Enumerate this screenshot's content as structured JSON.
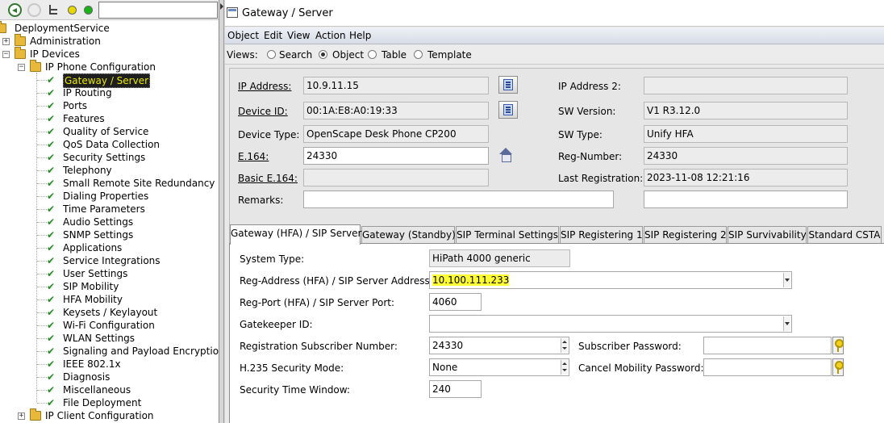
{
  "left_toolbar": {
    "search_value": ""
  },
  "tree": {
    "root": "DeploymentService",
    "administration": "Administration",
    "ip_devices": "IP Devices",
    "ip_phone_configuration": "IP Phone Configuration",
    "items": [
      "Gateway / Server",
      "IP Routing",
      "Ports",
      "Features",
      "Quality of Service",
      "QoS Data Collection",
      "Security Settings",
      "Telephony",
      "Small Remote Site Redundancy",
      "Dialing Properties",
      "Time Parameters",
      "Audio Settings",
      "SNMP Settings",
      "Applications",
      "Service Integrations",
      "User Settings",
      "SIP Mobility",
      "HFA Mobility",
      "Keysets / Keylayout",
      "Wi-Fi Configuration",
      "WLAN Settings",
      "Signaling and Payload Encryption (",
      "IEEE 802.1x",
      "Diagnosis",
      "Miscellaneous",
      "File Deployment"
    ],
    "ip_client_configuration": "IP Client Configuration",
    "selected_index": 0
  },
  "window": {
    "title": "Gateway / Server"
  },
  "menu": [
    "Object",
    "Edit",
    "View",
    "Action",
    "Help"
  ],
  "views": {
    "label": "Views:",
    "options": [
      "Search",
      "Object",
      "Table",
      "Template"
    ],
    "selected": "Object"
  },
  "form": {
    "ip_address": {
      "label": "IP Address:",
      "value": "10.9.11.15"
    },
    "device_id": {
      "label": "Device ID:",
      "value": "00:1A:E8:A0:19:33"
    },
    "device_type": {
      "label": "Device Type:",
      "value": "OpenScape Desk Phone CP200"
    },
    "e164": {
      "label": "E.164:",
      "value": "24330"
    },
    "basic_e164": {
      "label": "Basic E.164:",
      "value": ""
    },
    "remarks": {
      "label": "Remarks:",
      "value": ""
    },
    "ip_address_2": {
      "label": "IP Address 2:",
      "value": ""
    },
    "sw_version": {
      "label": "SW Version:",
      "value": "V1 R3.12.0"
    },
    "sw_type": {
      "label": "SW Type:",
      "value": "Unify HFA"
    },
    "reg_number": {
      "label": "Reg-Number:",
      "value": "24330"
    },
    "last_registration": {
      "label": "Last Registration:",
      "value": "2023-11-08 12:21:16"
    },
    "remarks_right": {
      "value": ""
    }
  },
  "tabs": [
    "Gateway (HFA) / SIP Server",
    "Gateway (Standby)",
    "SIP Terminal Settings",
    "SIP Registering 1",
    "SIP Registering 2",
    "SIP Survivability",
    "Standard CSTA"
  ],
  "active_tab": 0,
  "gateway": {
    "system_type": {
      "label": "System Type:",
      "value": "HiPath 4000 generic"
    },
    "reg_address": {
      "label": "Reg-Address (HFA) / SIP Server Address:",
      "value": "10.100.111.233"
    },
    "reg_port": {
      "label": "Reg-Port (HFA) / SIP Server Port:",
      "value": "4060"
    },
    "gatekeeper_id": {
      "label": "Gatekeeper ID:",
      "value": ""
    },
    "registration_subscriber_number": {
      "label": "Registration Subscriber Number:",
      "value": "24330"
    },
    "subscriber_password": {
      "label": "Subscriber Password:",
      "value": ""
    },
    "h235_security_mode": {
      "label": "H.235 Security Mode:",
      "value": "None"
    },
    "cancel_mobility_password": {
      "label": "Cancel Mobility Password:",
      "value": ""
    },
    "security_time_window": {
      "label": "Security Time Window:",
      "value": "240"
    }
  },
  "colors": {
    "highlight": "#ffff33",
    "selection_bg": "#1e1e1e",
    "selection_fg": "#e8e800",
    "check": "#1f8f1f"
  }
}
